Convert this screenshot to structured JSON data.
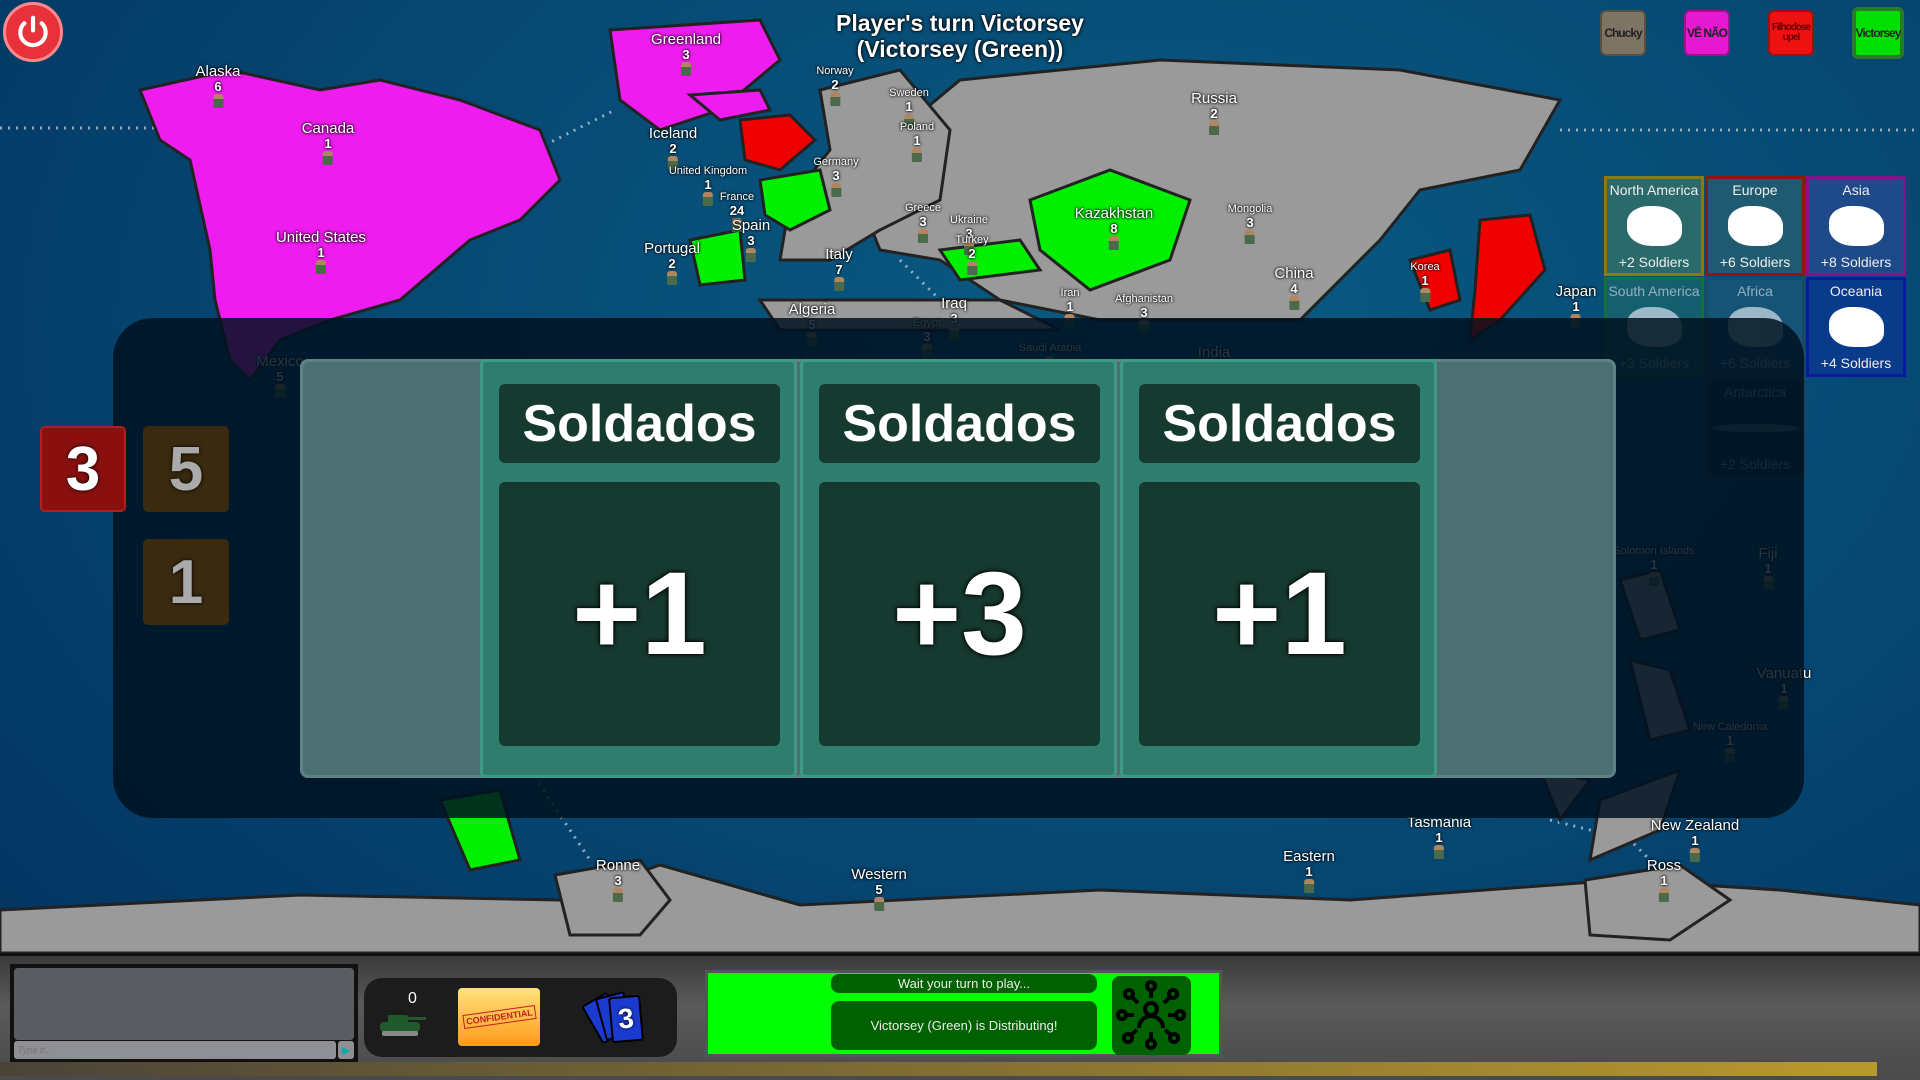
{
  "title": {
    "line1": "Player's turn Victorsey",
    "line2": "(Victorsey (Green))"
  },
  "players": [
    {
      "name": "Chucky",
      "color": "#7d7464"
    },
    {
      "name": "VÊ NÃO",
      "color": "#e619d0"
    },
    {
      "name": "Filhodose upel",
      "color": "#ee1111"
    },
    {
      "name": "Victorsey",
      "color": "#00e000",
      "active": true
    }
  ],
  "colors": {
    "magenta": "#ee1cee",
    "green": "#00f000",
    "red": "#f00000",
    "gray": "#8c8c8c"
  },
  "territories": [
    {
      "name": "Alaska",
      "count": "6",
      "owner": "magenta"
    },
    {
      "name": "Canada",
      "count": "1",
      "owner": "magenta"
    },
    {
      "name": "United States",
      "count": "1",
      "owner": "magenta"
    },
    {
      "name": "Mexico",
      "count": "5",
      "owner": "magenta"
    },
    {
      "name": "Greenland",
      "count": "3",
      "owner": "magenta"
    },
    {
      "name": "Iceland",
      "count": "2",
      "owner": "magenta"
    },
    {
      "name": "Norway",
      "count": "2",
      "owner": "gray"
    },
    {
      "name": "Sweden",
      "count": "1",
      "owner": "gray"
    },
    {
      "name": "United Kingdom",
      "count": "1",
      "owner": "red"
    },
    {
      "name": "France",
      "count": "24",
      "owner": "green"
    },
    {
      "name": "Germany",
      "count": "3",
      "owner": "gray"
    },
    {
      "name": "Poland",
      "count": "1",
      "owner": "gray"
    },
    {
      "name": "Spain",
      "count": "3",
      "owner": "gray"
    },
    {
      "name": "Portugal",
      "count": "2",
      "owner": "green"
    },
    {
      "name": "Italy",
      "count": "7",
      "owner": "gray"
    },
    {
      "name": "Greece",
      "count": "3",
      "owner": "gray"
    },
    {
      "name": "Ukraine",
      "count": "3",
      "owner": "gray"
    },
    {
      "name": "Turkey",
      "count": "2",
      "owner": "green"
    },
    {
      "name": "Russia",
      "count": "2",
      "owner": "gray"
    },
    {
      "name": "Kazakhstan",
      "count": "8",
      "owner": "green"
    },
    {
      "name": "Mongolia",
      "count": "3",
      "owner": "gray"
    },
    {
      "name": "China",
      "count": "4",
      "owner": "gray"
    },
    {
      "name": "Korea",
      "count": "1",
      "owner": "red"
    },
    {
      "name": "Japan",
      "count": "1",
      "owner": "red"
    },
    {
      "name": "Iraq",
      "count": "3",
      "owner": "gray"
    },
    {
      "name": "Iran",
      "count": "1",
      "owner": "green"
    },
    {
      "name": "Afghanistan",
      "count": "3",
      "owner": "gray"
    },
    {
      "name": "Algeria",
      "count": "5",
      "owner": "gray"
    },
    {
      "name": "Egypt",
      "count": "3",
      "owner": "gray"
    },
    {
      "name": "Saudi Arabia",
      "count": "",
      "owner": "green"
    },
    {
      "name": "India",
      "count": "",
      "owner": "green"
    },
    {
      "name": "Solomon Islands",
      "count": "1",
      "owner": "gray"
    },
    {
      "name": "Fiji",
      "count": "1",
      "owner": "gray"
    },
    {
      "name": "Vanuatu",
      "count": "1",
      "owner": "gray"
    },
    {
      "name": "New Caledonia",
      "count": "1",
      "owner": "gray"
    },
    {
      "name": "Tasmania",
      "count": "1",
      "owner": "gray"
    },
    {
      "name": "New Zealand",
      "count": "1",
      "owner": "gray"
    },
    {
      "name": "Ronne",
      "count": "3",
      "owner": "gray"
    },
    {
      "name": "Western",
      "count": "5",
      "owner": "gray"
    },
    {
      "name": "Eastern",
      "count": "1",
      "owner": "gray"
    },
    {
      "name": "Ross",
      "count": "1",
      "owner": "gray"
    }
  ],
  "continents": [
    {
      "name": "North America",
      "bonus": "+2 Soldiers",
      "border": "#8a7a10",
      "bg": "#2a6a6a"
    },
    {
      "name": "Europe",
      "bonus": "+6 Soldiers",
      "border": "#8a1a10",
      "bg": "#1f5a70"
    },
    {
      "name": "Asia",
      "bonus": "+8 Soldiers",
      "border": "#8a108a",
      "bg": "#1f4a8a"
    },
    {
      "name": "South America",
      "bonus": "+3 Soldiers",
      "border": "#1a8a10",
      "bg": "#1f6a6a"
    },
    {
      "name": "Africa",
      "bonus": "+6 Soldiers",
      "border": "#2a4a5a",
      "bg": "#1f5a78"
    },
    {
      "name": "Oceania",
      "bonus": "+4 Soldiers",
      "border": "#0a1aa0",
      "bg": "#0a3a8a"
    },
    {
      "name": "Antarctica",
      "bonus": "+2 Soldiers",
      "border": "#3a3a3a",
      "bg": "#0a2030"
    }
  ],
  "cards": [
    {
      "label": "Soldados",
      "value": "+1"
    },
    {
      "label": "Soldados",
      "value": "+3"
    },
    {
      "label": "Soldados",
      "value": "+1"
    }
  ],
  "dice": [
    {
      "value": "3",
      "color": "#8a1010"
    },
    {
      "value": "5",
      "color": "#3a2a10"
    },
    {
      "value": "1",
      "color": "#3a2a10"
    }
  ],
  "chat": {
    "placeholder": "Type it..."
  },
  "items": {
    "tanks": "0",
    "folder_label": "CONFIDENTIAL",
    "cards": "3"
  },
  "status": {
    "line1": "Wait your turn to play...",
    "line2": "Victorsey (Green) is Distributing!"
  },
  "icons": [
    "power-icon",
    "tank-icon",
    "folder-icon",
    "cards-icon",
    "network-icon",
    "send-icon"
  ]
}
